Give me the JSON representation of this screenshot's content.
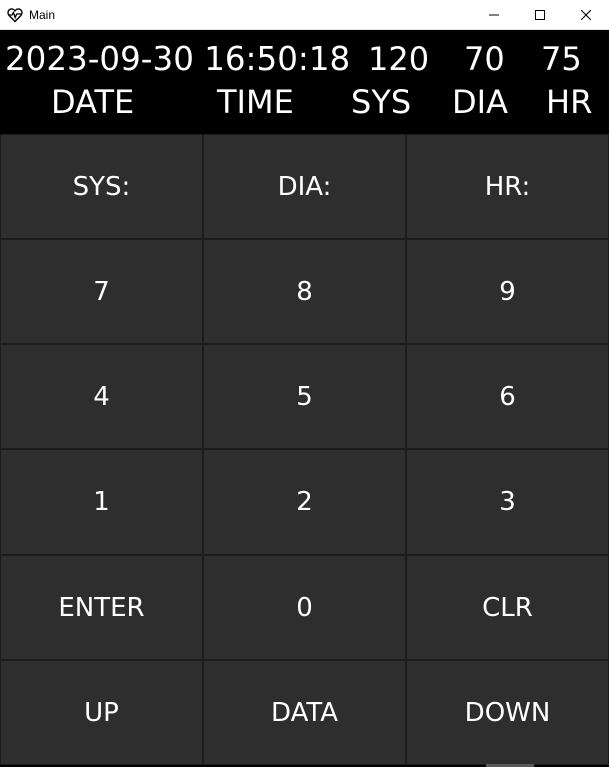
{
  "window": {
    "title": "Main",
    "app_icon": "heart-pulse-icon",
    "controls": [
      "minimize-icon",
      "maximize-icon",
      "close-icon"
    ]
  },
  "header": {
    "datetime": "2023-09-30 16:50:18",
    "sys_value": "120",
    "dia_value": "70",
    "hr_value": "75",
    "date_label": "DATE",
    "time_label": "TIME",
    "sys_label": "SYS",
    "dia_label": "DIA",
    "hr_label": "HR"
  },
  "keypad": {
    "rows": [
      [
        "SYS:",
        "DIA:",
        "HR:"
      ],
      [
        "7",
        "8",
        "9"
      ],
      [
        "4",
        "5",
        "6"
      ],
      [
        "1",
        "2",
        "3"
      ],
      [
        "ENTER",
        "0",
        "CLR"
      ],
      [
        "UP",
        "DATA",
        "DOWN"
      ]
    ]
  },
  "colors": {
    "background": "#000000",
    "key_background": "#2e2e2e",
    "key_border": "#1c1c1c",
    "text": "#ffffff",
    "titlebar": "#ffffff"
  }
}
